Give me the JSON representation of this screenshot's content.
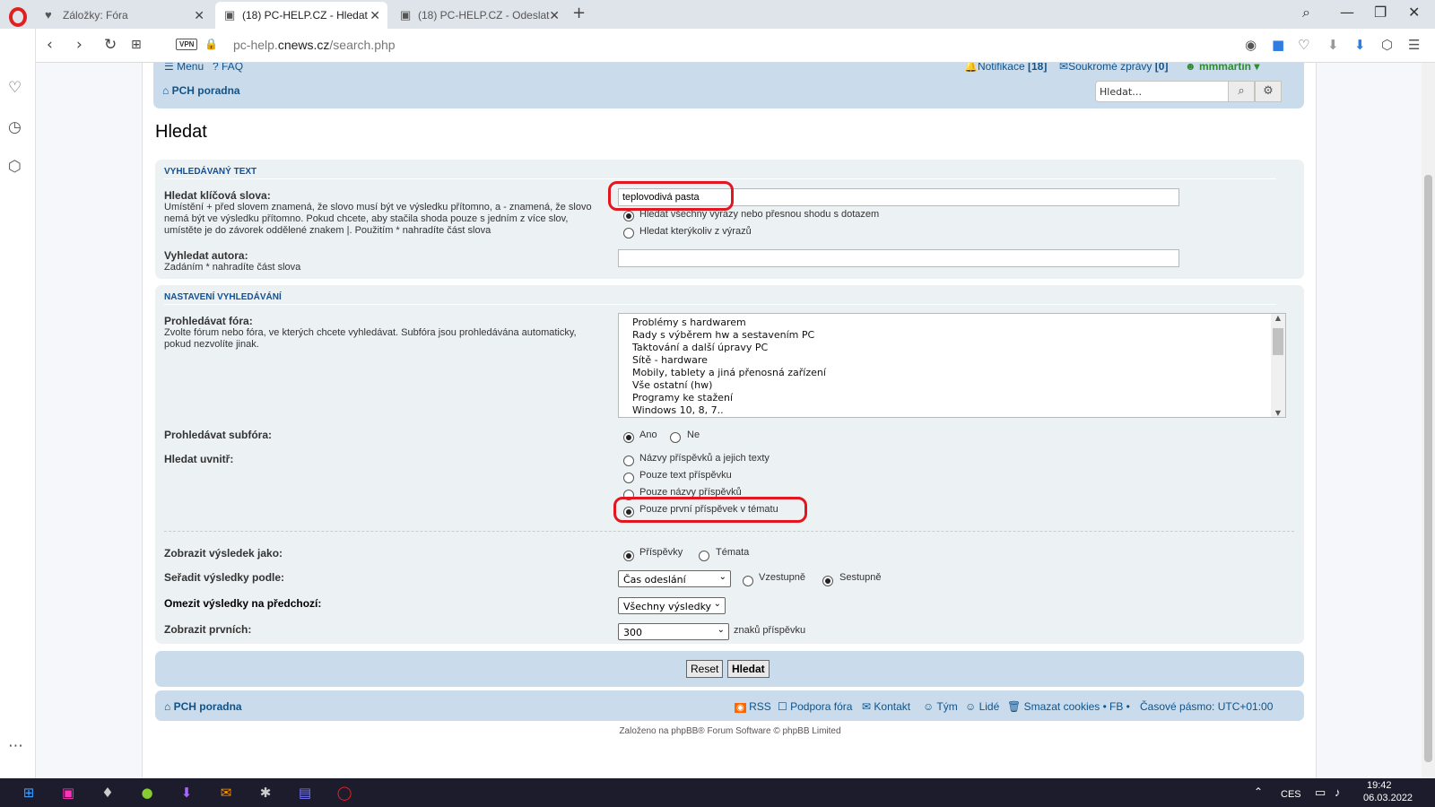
{
  "browser": {
    "tabs": [
      {
        "title": "Záložky: Fóra",
        "icon": "heart-icon"
      },
      {
        "title": "(18) PC-HELP.CZ - Hledat",
        "icon": "computer-icon",
        "active": true
      },
      {
        "title": "(18) PC-HELP.CZ - Odeslat ",
        "icon": "computer-icon"
      }
    ],
    "url_prefix": "pc-help.",
    "url_domain": "cnews.cz",
    "url_path": "/search.php",
    "vpn_label": "VPN"
  },
  "header": {
    "menu_label": "Menu",
    "faq_label": "FAQ",
    "notifications_label": "Notifikace",
    "notifications_count": "[18]",
    "pm_label": "Soukromé zprávy",
    "pm_count": "[0]",
    "username": "mmmartin",
    "forum_link": "PCH poradna",
    "search_placeholder": "Hledat…"
  },
  "page_title": "Hledat",
  "search_text": {
    "section_title": "Vyhledávaný text",
    "keywords_label": "Hledat klíčová slova:",
    "keywords_desc": "Umístění + před slovem znamená, že slovo musí být ve výsledku přítomno, a - znamená, že slovo nemá být ve výsledku přítomno. Pokud chcete, aby stačila shoda pouze s jedním z více slov, umístěte je do závorek oddělené znakem |. Použitím * nahradíte část slova",
    "keywords_value": "teplovodivá pasta",
    "opt_all": "Hledat všechny výrazy nebo přesnou shodu s dotazem",
    "opt_any": "Hledat kterýkoliv z výrazů",
    "author_label": "Vyhledat autora:",
    "author_desc": "Zadáním * nahradíte část slova",
    "author_value": ""
  },
  "settings": {
    "section_title": "Nastavení vyhledávání",
    "forums_label": "Prohledávat fóra:",
    "forums_desc": "Zvolte fórum nebo fóra, ve kterých chcete vyhledávat. Subfóra jsou prohledávána automaticky, pokud nezvolíte jinak.",
    "forums": [
      "Problémy s hardwarem",
      "Rady s výběrem hw a sestavením PC",
      "Taktování a další úpravy PC",
      "Sítě - hardware",
      "Mobily, tablety a jiná přenosná zařízení",
      "Vše ostatní (hw)",
      "Programy ke stažení",
      "Windows 10, 8, 7.."
    ],
    "subforums_label": "Prohledávat subfóra:",
    "yes": "Ano",
    "no": "Ne",
    "search_within_label": "Hledat uvnitř:",
    "within_options": [
      "Názvy příspěvků a jejich texty",
      "Pouze text příspěvku",
      "Pouze názvy příspěvků",
      "Pouze první příspěvek v tématu"
    ],
    "display_label": "Zobrazit výsledek jako:",
    "display_posts": "Příspěvky",
    "display_topics": "Témata",
    "sort_label": "Seřadit výsledky podle:",
    "sort_value": "Čas odeslání",
    "asc": "Vzestupně",
    "desc": "Sestupně",
    "limit_label": "Omezit výsledky na předchozí:",
    "limit_value": "Všechny výsledky",
    "return_label": "Zobrazit prvních:",
    "return_value": "300",
    "return_suffix": "znaků příspěvku"
  },
  "buttons": {
    "reset": "Reset",
    "search": "Hledat"
  },
  "footer": {
    "forum_link": "PCH poradna",
    "rss": "RSS",
    "support": "Podpora fóra",
    "contact": "Kontakt",
    "team": "Tým",
    "people": "Lidé",
    "cookies": "Smazat cookies",
    "fb": "FB",
    "timezone": "Časové pásmo: UTC+01:00",
    "powered": "Založeno na phpBB® Forum Software © phpBB Limited"
  },
  "taskbar": {
    "lang": "CES",
    "time": "19:42",
    "date": "06.03.2022"
  },
  "colors": {
    "highlight": "#e3151e",
    "accent": "#105289",
    "panel": "#ecf1f3",
    "header": "#cadceb"
  }
}
